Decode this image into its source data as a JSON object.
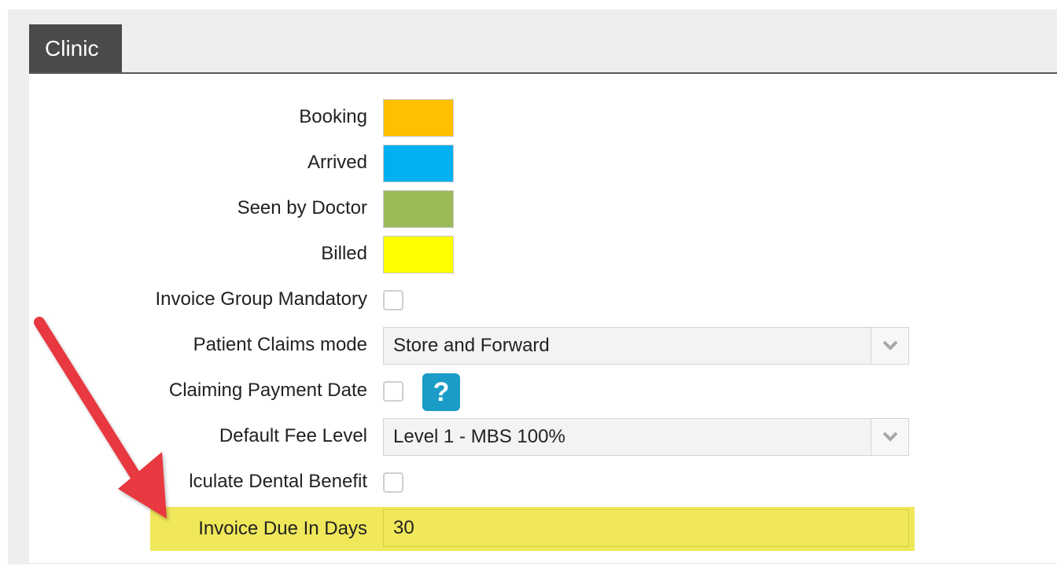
{
  "tab": {
    "label": "Clinic"
  },
  "colors": {
    "booking": "#FFC000",
    "arrived": "#00B0F0",
    "seen_by_doctor": "#9BBB59",
    "billed": "#FFFF00",
    "help_button": "#1A9CC6",
    "highlight": "#F0E85A",
    "arrow": "#E8373F"
  },
  "fields": {
    "booking_label": "Booking",
    "arrived_label": "Arrived",
    "seen_label": "Seen by Doctor",
    "billed_label": "Billed",
    "invoice_group_label": "Invoice Group Mandatory",
    "patient_claims_label": "Patient Claims mode",
    "patient_claims_value": "Store and Forward",
    "claiming_payment_label": "Claiming Payment Date",
    "help_icon": "?",
    "default_fee_label": "Default Fee Level",
    "default_fee_value": "Level 1 - MBS 100%",
    "dental_benefit_label": "lculate Dental Benefit",
    "invoice_due_label": "Invoice Due In Days",
    "invoice_due_value": "30"
  },
  "icons": {
    "dropdown": "chevron-down-icon",
    "help": "help-icon",
    "annotation": "red-arrow-icon"
  }
}
